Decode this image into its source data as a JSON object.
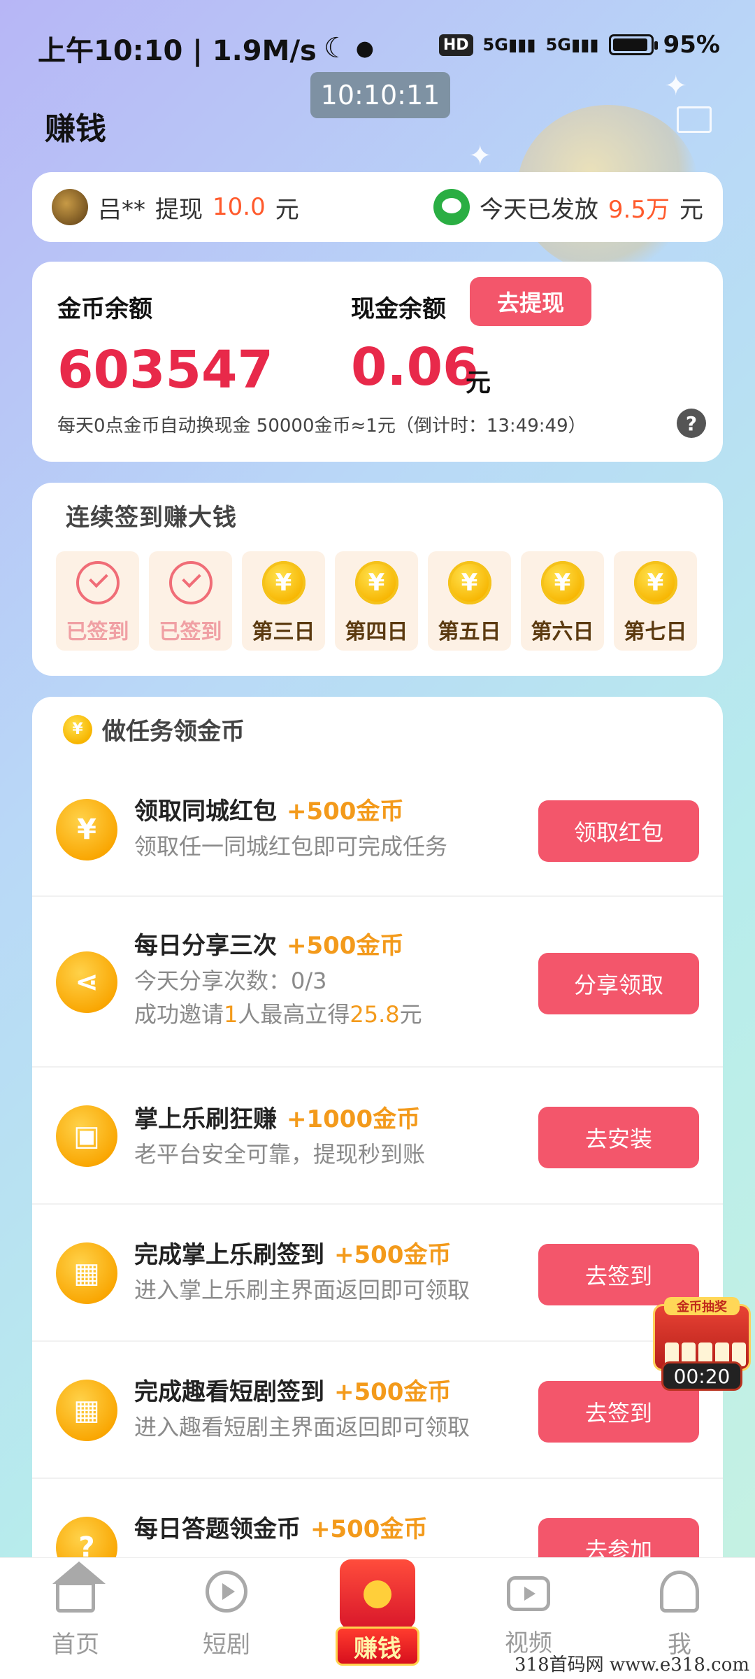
{
  "status_bar": {
    "time_speed": "上午10:10 | 1.9M/s",
    "hd": "HD",
    "signal1": "5G",
    "signal2": "5G",
    "battery": "95%",
    "battery_level": 0.95
  },
  "clock_overlay": "10:10:11",
  "page_title": "赚钱",
  "ticker": {
    "user": "吕**",
    "withdraw_text": "提现",
    "withdraw_amount": "10.0",
    "unit": "元",
    "today_text": "今天已发放",
    "today_amount": "9.5万",
    "today_unit": "元"
  },
  "balance": {
    "coin_label": "金币余额",
    "coin_value": "603547",
    "cash_label": "现金余额",
    "withdraw_button": "去提现",
    "cash_value": "0.06",
    "cash_unit": "元",
    "note": "每天0点金币自动换现金 50000金币≈1元（倒计时：13:49:49）",
    "help": "?"
  },
  "signin": {
    "title": "连续签到赚大钱",
    "days": [
      {
        "label": "已签到",
        "state": "done"
      },
      {
        "label": "已签到",
        "state": "done"
      },
      {
        "label": "第三日",
        "state": "todo"
      },
      {
        "label": "第四日",
        "state": "todo"
      },
      {
        "label": "第五日",
        "state": "todo"
      },
      {
        "label": "第六日",
        "state": "todo"
      },
      {
        "label": "第七日",
        "state": "todo"
      }
    ],
    "coin_symbol": "¥"
  },
  "tasks": {
    "header": "做任务领金币",
    "items": [
      {
        "icon": "yen-coin-icon",
        "title": "领取同城红包",
        "reward": "+500金币",
        "desc": [
          "领取任一同城红包即可完成任务"
        ],
        "button": "领取红包"
      },
      {
        "icon": "share-icon",
        "title": "每日分享三次",
        "reward": "+500金币",
        "desc": [
          "今天分享次数：0/3"
        ],
        "desc2_pre": "成功邀请",
        "desc2_num": "1",
        "desc2_mid": "人最高立得",
        "desc2_amt": "25.8",
        "desc2_post": "元",
        "button": "分享领取"
      },
      {
        "icon": "android-icon",
        "title": "掌上乐刷狂赚",
        "reward": "+1000金币",
        "desc": [
          "老平台安全可靠，提现秒到账"
        ],
        "button": "去安装"
      },
      {
        "icon": "calendar-check-icon",
        "title": "完成掌上乐刷签到",
        "reward": "+500金币",
        "desc": [
          "进入掌上乐刷主界面返回即可领取"
        ],
        "button": "去签到"
      },
      {
        "icon": "calendar-check-icon",
        "title": "完成趣看短剧签到",
        "reward": "+500金币",
        "desc": [
          "进入趣看短剧主界面返回即可领取"
        ],
        "button": "去签到"
      },
      {
        "icon": "question-book-icon",
        "title": "每日答题领金币",
        "reward": "+500金币",
        "desc": [
          ""
        ],
        "button": "去参加"
      }
    ]
  },
  "lottery": {
    "title": "金币抽奖",
    "timer": "00:20"
  },
  "nav": {
    "home": "首页",
    "drama": "短剧",
    "earn": "赚钱",
    "video": "视频",
    "me": "我"
  },
  "watermark": "318首码网 www.e318.com"
}
